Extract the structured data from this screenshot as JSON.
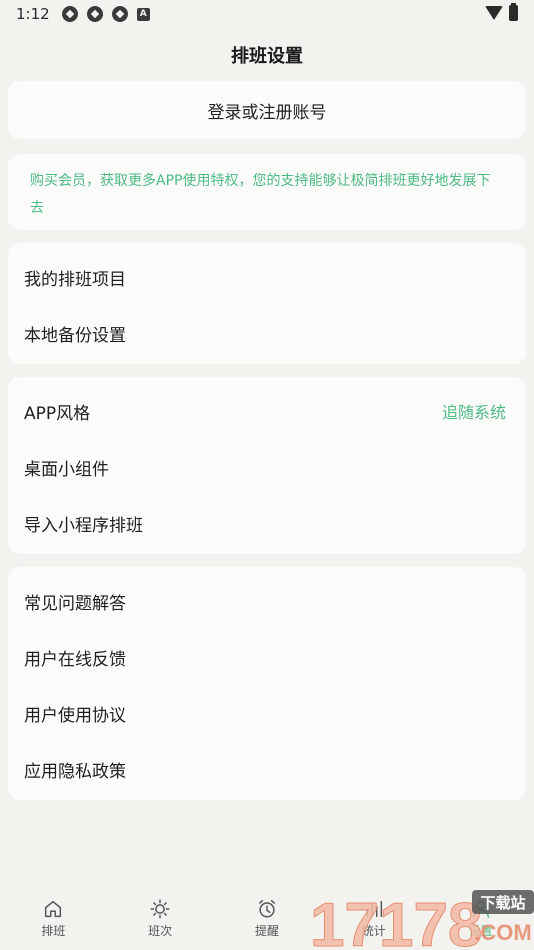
{
  "status_bar": {
    "time": "1:12",
    "badge": "A"
  },
  "header": {
    "title": "排班设置"
  },
  "login": {
    "label": "登录或注册账号"
  },
  "promo": {
    "text": "购买会员，获取更多APP使用特权，您的支持能够让极简排班更好地发展下去",
    "color": "#4dbb84"
  },
  "group1": {
    "items": [
      {
        "label": "我的排班项目"
      },
      {
        "label": "本地备份设置"
      }
    ]
  },
  "group2": {
    "items": [
      {
        "label": "APP风格",
        "value": "追随系统"
      },
      {
        "label": "桌面小组件"
      },
      {
        "label": "导入小程序排班"
      }
    ]
  },
  "group3": {
    "items": [
      {
        "label": "常见问题解答"
      },
      {
        "label": "用户在线反馈"
      },
      {
        "label": "用户使用协议"
      },
      {
        "label": "应用隐私政策"
      }
    ]
  },
  "bottom_nav": {
    "items": [
      {
        "label": "排班",
        "icon": "home-icon"
      },
      {
        "label": "班次",
        "icon": "sun-icon"
      },
      {
        "label": "提醒",
        "icon": "alarm-icon"
      },
      {
        "label": "统计",
        "icon": "chart-icon"
      },
      {
        "label": "设置",
        "icon": "user-icon"
      }
    ],
    "active_color": "#4dbb84"
  },
  "watermark": {
    "text": "17178",
    "sub_text": "下载站",
    "domain": ".COM"
  }
}
